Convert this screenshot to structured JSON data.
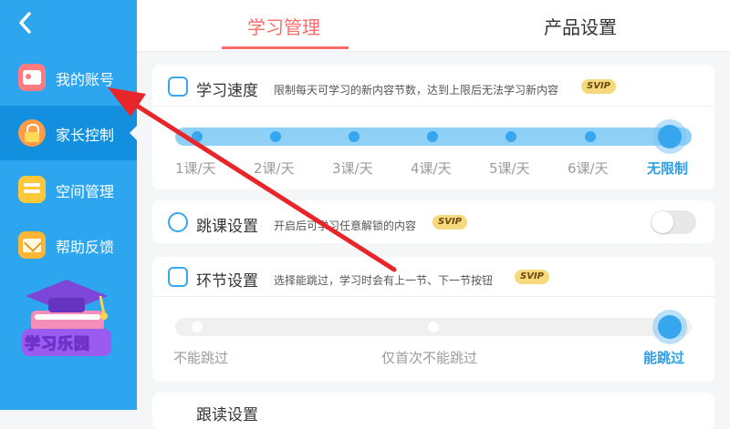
{
  "sidebar": {
    "back_icon": "chevron-left-icon",
    "items": [
      {
        "label": "我的账号",
        "icon": "account-card-icon"
      },
      {
        "label": "家长控制",
        "icon": "lock-icon"
      },
      {
        "label": "空间管理",
        "icon": "storage-icon"
      },
      {
        "label": "帮助反馈",
        "icon": "mail-icon"
      }
    ],
    "active_index": 1,
    "mascot_label": "学习乐园"
  },
  "tabs": [
    {
      "label": "学习管理",
      "active": true
    },
    {
      "label": "产品设置",
      "active": false
    }
  ],
  "study_speed": {
    "title": "学习速度",
    "desc": "限制每天可学习的新内容节数，达到上限后无法学习新内容",
    "badge": "SVIP",
    "options": [
      "1课/天",
      "2课/天",
      "3课/天",
      "4课/天",
      "5课/天",
      "6课/天",
      "无限制"
    ],
    "selected_index": 6
  },
  "skip_lesson": {
    "title": "跳课设置",
    "desc": "开启后可学习任意解锁的内容",
    "badge": "SVIP",
    "enabled": false
  },
  "step_setting": {
    "title": "环节设置",
    "desc": "选择能跳过，学习时会有上一节、下一节按钮",
    "badge": "SVIP",
    "options": [
      "不能跳过",
      "仅首次不能跳过",
      "能跳过"
    ],
    "selected_index": 2
  },
  "next_card": {
    "title": "跟读设置"
  },
  "colors": {
    "sidebar": "#2ea5ef",
    "accent_tab": "#ff6b6b",
    "slider": "#37a6ef",
    "annotation_arrow": "#e8262a"
  }
}
